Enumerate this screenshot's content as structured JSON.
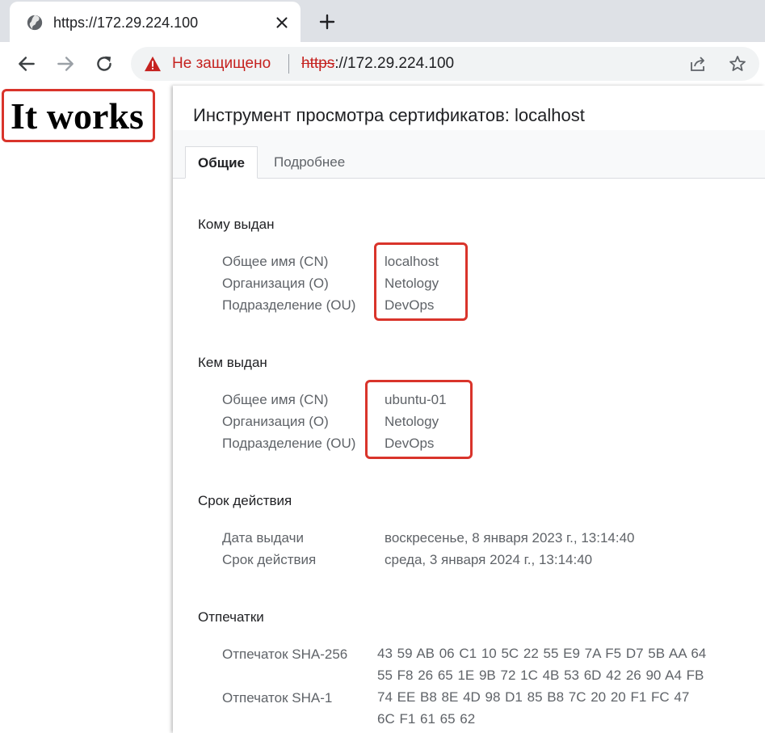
{
  "browser": {
    "tab": {
      "title": "https://172.29.224.100",
      "favicon": "globe-icon",
      "close_icon": "close-icon"
    },
    "new_tab_icon": "plus-icon",
    "nav": {
      "back_icon": "back-arrow-icon",
      "forward_icon": "forward-arrow-icon",
      "reload_icon": "reload-icon"
    },
    "omnibox": {
      "warning_icon": "warning-triangle-icon",
      "security_text": "Не защищено",
      "url_scheme": "https",
      "url_rest": "://172.29.224.100",
      "share_icon": "share-icon",
      "bookmark_icon": "star-icon"
    }
  },
  "page": {
    "heading": "It works"
  },
  "cert_viewer": {
    "title": "Инструмент просмотра сертификатов: localhost",
    "tabs": [
      {
        "label": "Общие",
        "active": true
      },
      {
        "label": "Подробнее",
        "active": false
      }
    ],
    "issued_to": {
      "heading": "Кому выдан",
      "fields": [
        {
          "label": "Общее имя (CN)",
          "value": "localhost"
        },
        {
          "label": "Организация (O)",
          "value": "Netology"
        },
        {
          "label": "Подразделение (OU)",
          "value": "DevOps"
        }
      ]
    },
    "issued_by": {
      "heading": "Кем выдан",
      "fields": [
        {
          "label": "Общее имя (CN)",
          "value": "ubuntu-01"
        },
        {
          "label": "Организация (O)",
          "value": "Netology"
        },
        {
          "label": "Подразделение (OU)",
          "value": "DevOps"
        }
      ]
    },
    "validity": {
      "heading": "Срок действия",
      "fields": [
        {
          "label": "Дата выдачи",
          "value": "воскресенье, 8 января 2023 г., 13:14:40"
        },
        {
          "label": "Срок действия",
          "value": "среда, 3 января 2024 г., 13:14:40"
        }
      ]
    },
    "fingerprints": {
      "heading": "Отпечатки",
      "fields": [
        {
          "label": "Отпечаток SHA-256",
          "value": "43 59 AB 06 C1 10 5C 22 55 E9 7A F5 D7 5B AA 64 55 F8 26 65 1E 9B 72 1C 4B 53 6D 42 26 90 A4 FB"
        },
        {
          "label": "Отпечаток SHA-1",
          "value": "74 EE B8 8E 4D 98 D1 85 B8 7C 20 20 F1 FC 47 6C F1 61 65 62"
        }
      ]
    }
  },
  "colors": {
    "highlight": "#d9342b",
    "warning": "#c5221f",
    "tabstrip": "#dee1e6"
  }
}
